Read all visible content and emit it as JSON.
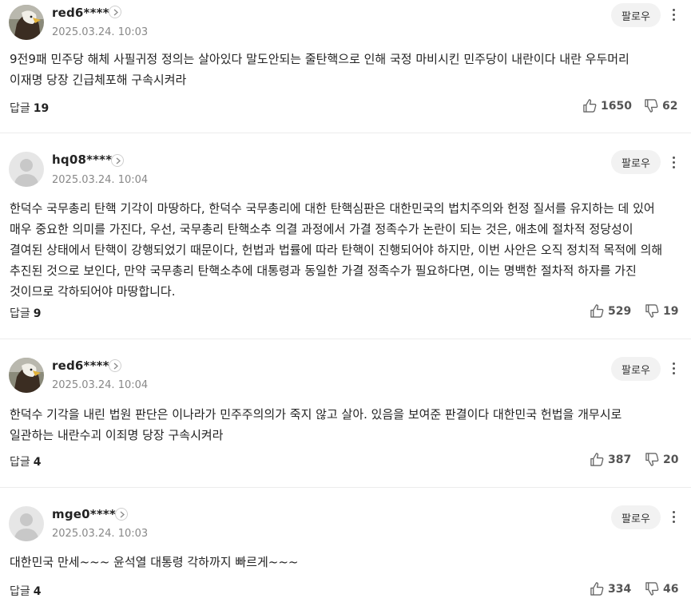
{
  "comments": [
    {
      "nickname": "red6****",
      "date": "2025.03.24. 10:03",
      "follow_label": "팔로우",
      "avatar": "eagle",
      "text": "9전9패 민주당 해체 사필귀정 정의는 살아있다 말도안되는 줄탄핵으로 인해 국정 마비시킨 민주당이 내란이다 내란 우두머리 이재명 당장 긴급체포해 구속시켜라",
      "reply_label": "답글",
      "reply_count": "19",
      "likes": "1650",
      "dislikes": "62"
    },
    {
      "nickname": "hq08****",
      "date": "2025.03.24. 10:04",
      "follow_label": "팔로우",
      "avatar": "default",
      "text": "한덕수 국무총리 탄핵 기각이 마땅하다, 한덕수 국무총리에 대한 탄핵심판은 대한민국의 법치주의와 헌정 질서를 유지하는 데 있어 매우 중요한 의미를 가진다, 우선, 국무총리 탄핵소추 의결 과정에서 가결 정족수가 논란이 되는 것은, 애초에 절차적 정당성이 결여된 상태에서 탄핵이 강행되었기 때문이다, 헌법과 법률에 따라 탄핵이 진행되어야 하지만, 이번 사안은 오직 정치적 목적에 의해 추진된 것으로 보인다, 만약 국무총리 탄핵소추에 대통령과 동일한 가결 정족수가 필요하다면, 이는 명백한 절차적 하자를 가진 것이므로 각하되어야 마땅합니다.",
      "reply_label": "답글",
      "reply_count": "9",
      "likes": "529",
      "dislikes": "19"
    },
    {
      "nickname": "red6****",
      "date": "2025.03.24. 10:04",
      "follow_label": "팔로우",
      "avatar": "eagle",
      "text": "한덕수 기각을 내린 법원 판단은 이나라가 민주주의의가 죽지 않고 살아. 있음을 보여준 판결이다 대한민국 헌법을 개무시로 일관하는 내란수괴 이죄명 당장 구속시켜라",
      "reply_label": "답글",
      "reply_count": "4",
      "likes": "387",
      "dislikes": "20"
    },
    {
      "nickname": "mge0****",
      "date": "2025.03.24. 10:03",
      "follow_label": "팔로우",
      "avatar": "default",
      "text": "대한민국 만세~~~ 윤석열 대통령 각하까지 빠르게~~~",
      "reply_label": "답글",
      "reply_count": "4",
      "likes": "334",
      "dislikes": "46"
    }
  ],
  "icons": {
    "profile_chevron": "chevron-right-icon",
    "like": "thumbs-up-icon",
    "dislike": "thumbs-down-icon",
    "more": "more-vertical-icon"
  },
  "colors": {
    "text": "#222222",
    "meta": "#888888",
    "follow_bg": "#f2f2f2",
    "divider": "#ececec"
  }
}
